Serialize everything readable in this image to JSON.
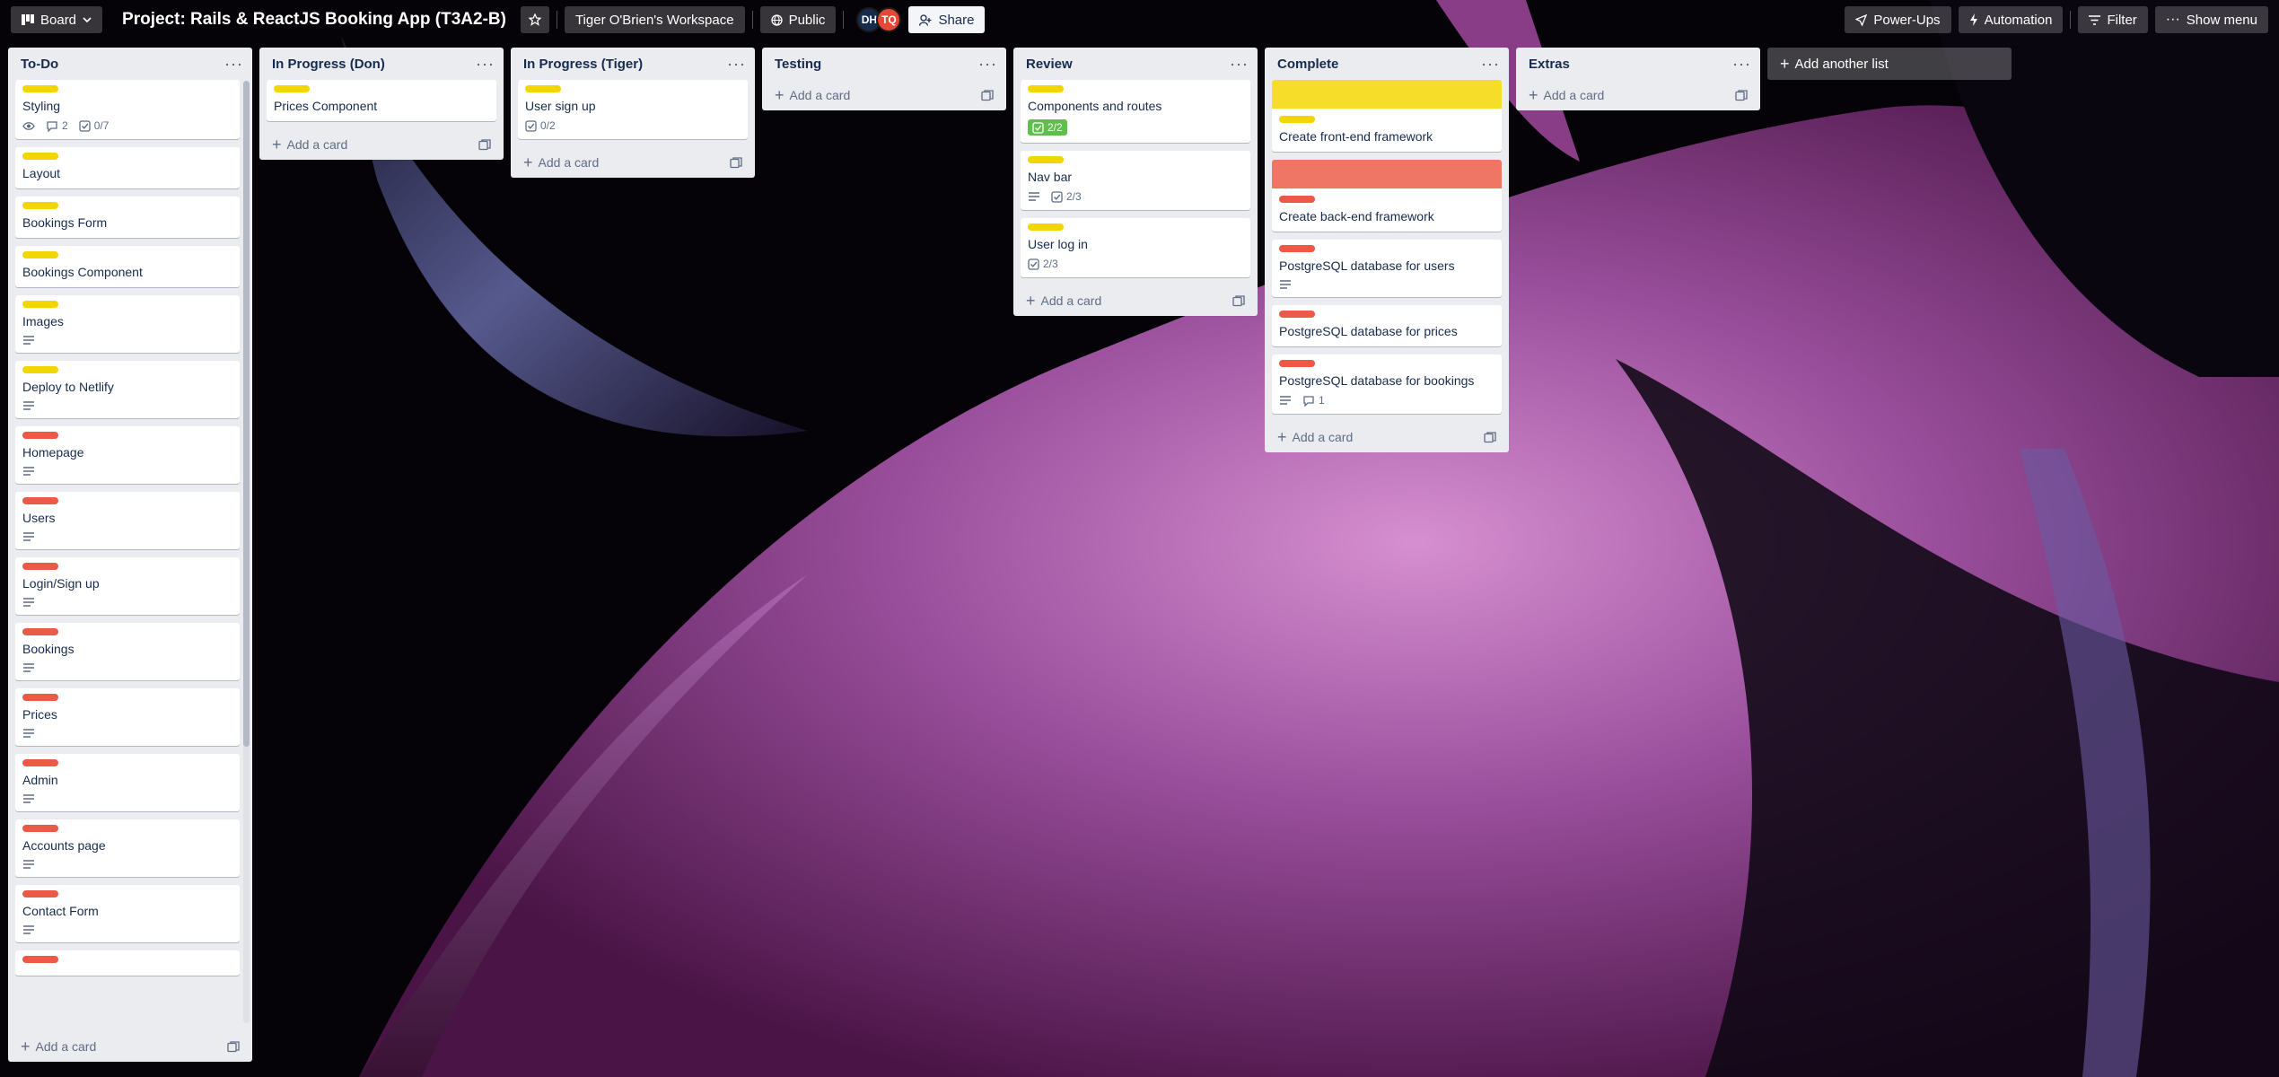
{
  "header": {
    "view_label": "Board",
    "board_title": "Project: Rails & ReactJS Booking App (T3A2-B)",
    "workspace": "Tiger O'Brien's Workspace",
    "visibility": "Public",
    "members": [
      "DH",
      "TQ"
    ],
    "share_label": "Share",
    "powerups_label": "Power-Ups",
    "automation_label": "Automation",
    "filter_label": "Filter",
    "menu_label": "Show menu"
  },
  "add_card_label": "Add a card",
  "add_list_label": "Add another list",
  "lists": [
    {
      "title": "To-Do",
      "cards": [
        {
          "title": "Styling",
          "label": "yellow",
          "badges": {
            "watch": true,
            "comments": "2",
            "checklist": "0/7"
          }
        },
        {
          "title": "Layout",
          "label": "yellow"
        },
        {
          "title": "Bookings Form",
          "label": "yellow"
        },
        {
          "title": "Bookings Component",
          "label": "yellow"
        },
        {
          "title": "Images",
          "label": "yellow",
          "badges": {
            "description": true
          }
        },
        {
          "title": "Deploy to Netlify",
          "label": "yellow",
          "badges": {
            "description": true
          }
        },
        {
          "title": "Homepage",
          "label": "red",
          "badges": {
            "description": true
          }
        },
        {
          "title": "Users",
          "label": "red",
          "badges": {
            "description": true
          }
        },
        {
          "title": "Login/Sign up",
          "label": "red",
          "badges": {
            "description": true
          }
        },
        {
          "title": "Bookings",
          "label": "red",
          "badges": {
            "description": true
          }
        },
        {
          "title": "Prices",
          "label": "red",
          "badges": {
            "description": true
          }
        },
        {
          "title": "Admin",
          "label": "red",
          "badges": {
            "description": true
          }
        },
        {
          "title": "Accounts page",
          "label": "red",
          "badges": {
            "description": true
          }
        },
        {
          "title": "Contact Form",
          "label": "red",
          "badges": {
            "description": true
          }
        },
        {
          "title": "",
          "label": "red"
        }
      ]
    },
    {
      "title": "In Progress (Don)",
      "cards": [
        {
          "title": "Prices Component",
          "label": "yellow"
        }
      ]
    },
    {
      "title": "In Progress (Tiger)",
      "cards": [
        {
          "title": "User sign up",
          "label": "yellow",
          "badges": {
            "checklist": "0/2"
          }
        }
      ]
    },
    {
      "title": "Testing",
      "cards": []
    },
    {
      "title": "Review",
      "cards": [
        {
          "title": "Components and routes",
          "label": "yellow",
          "badges": {
            "checklist_done": "2/2"
          }
        },
        {
          "title": "Nav bar",
          "label": "yellow",
          "badges": {
            "description": true,
            "checklist": "2/3"
          }
        },
        {
          "title": "User log in",
          "label": "yellow",
          "badges": {
            "checklist": "2/3"
          }
        }
      ]
    },
    {
      "title": "Complete",
      "cards": [
        {
          "title": "Create front-end framework",
          "label": "yellow",
          "cover": "#f5dd29"
        },
        {
          "title": "Create back-end framework",
          "label": "red",
          "cover": "#ef7564"
        },
        {
          "title": "PostgreSQL database for users",
          "label": "red",
          "badges": {
            "description": true
          }
        },
        {
          "title": "PostgreSQL database for prices",
          "label": "red"
        },
        {
          "title": "PostgreSQL database for bookings",
          "label": "red",
          "badges": {
            "description": true,
            "comments": "1"
          }
        }
      ]
    },
    {
      "title": "Extras",
      "cards": []
    }
  ]
}
